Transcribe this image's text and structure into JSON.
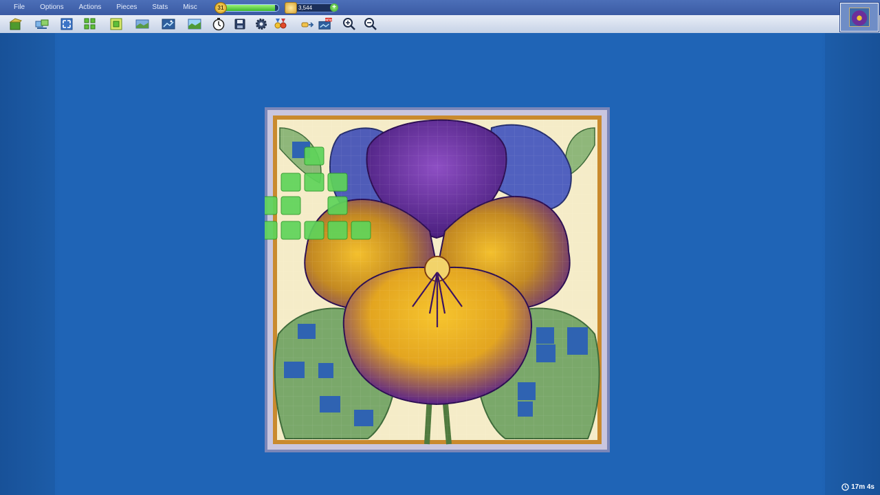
{
  "menu": {
    "items": [
      "File",
      "Options",
      "Actions",
      "Pieces",
      "Stats",
      "Misc"
    ]
  },
  "status": {
    "level": "31",
    "xp_progress": 0.94,
    "coins": "3,544",
    "coin_add_label": "+"
  },
  "toolbar": {
    "tools": [
      "puzzle-box-icon",
      "scatter-icon",
      "fullscreen-icon",
      "edge-pieces-icon",
      "frame-pieces-icon",
      "background-icon",
      "ghost-image-icon",
      "preview-image-icon",
      "timer-icon",
      "save-icon",
      "settings-icon",
      "achievements-icon",
      "coins-share-icon",
      "new-picture-icon",
      "zoom-in-icon",
      "zoom-out-icon"
    ],
    "new_badge": "NEW"
  },
  "timer": {
    "elapsed": "17m 4s"
  },
  "colors": {
    "background": "#1f64b6",
    "menubar": "#3a5aa3",
    "toolbar": "#d5deee",
    "piece_highlight": "#5fd45a"
  }
}
